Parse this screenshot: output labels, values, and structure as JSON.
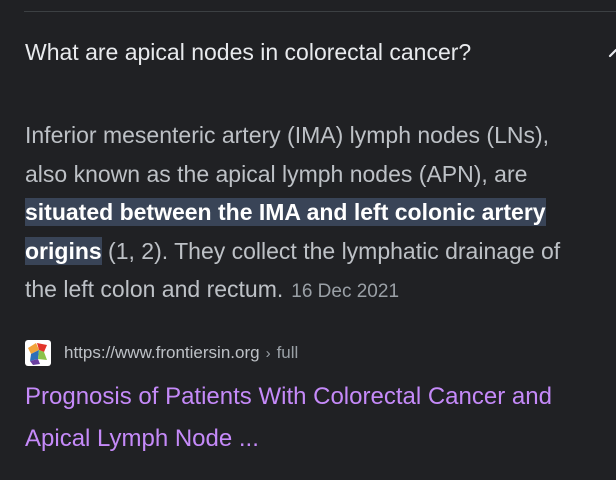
{
  "question": {
    "text": "What are apical nodes in colorectal cancer?",
    "icon": "chevron-up-icon"
  },
  "snippet": {
    "line1": "Inferior mesenteric artery (IMA) lymph nodes (LNs),",
    "line2": "also known as the apical lymph nodes (APN), are",
    "line3_highlight": "situated between the IMA and left colonic artery",
    "line4_highlight": "origins",
    "line4_rest": " (1, 2). They collect the lymphatic drainage of",
    "line5": "the left colon and rectum.",
    "date": "16 Dec 2021"
  },
  "source": {
    "favicon": "frontiers-favicon",
    "url": "https://www.frontiersin.org",
    "separator": "›",
    "path": "full"
  },
  "result": {
    "title_line1": "Prognosis of Patients With Colorectal Cancer and",
    "title_line2": "Apical Lymph Node ..."
  },
  "colors": {
    "background": "#202124",
    "text": "#e8eaed",
    "snippet_text": "#bdc1c6",
    "highlight_bg": "#394457",
    "link": "#c58af9",
    "muted": "#9aa0a6"
  }
}
